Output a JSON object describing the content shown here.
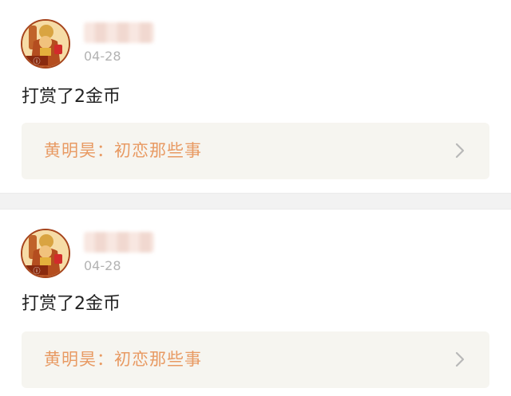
{
  "feed": {
    "items": [
      {
        "avatar_icon": "user-avatar-icon",
        "username": "",
        "date": "04-28",
        "message": "打赏了2金币",
        "link": {
          "label": "黄明昊：初恋那些事",
          "icon": "chevron-right-icon"
        }
      },
      {
        "avatar_icon": "user-avatar-icon",
        "username": "",
        "date": "04-28",
        "message": "打赏了2金币",
        "link": {
          "label": "黄明昊：初恋那些事",
          "icon": "chevron-right-icon"
        }
      }
    ]
  },
  "colors": {
    "link_text": "#e89a63",
    "link_background": "#f6f5f0",
    "date_text": "#b3b3b3",
    "message_text": "#222222",
    "separator": "#f2f2f2"
  }
}
